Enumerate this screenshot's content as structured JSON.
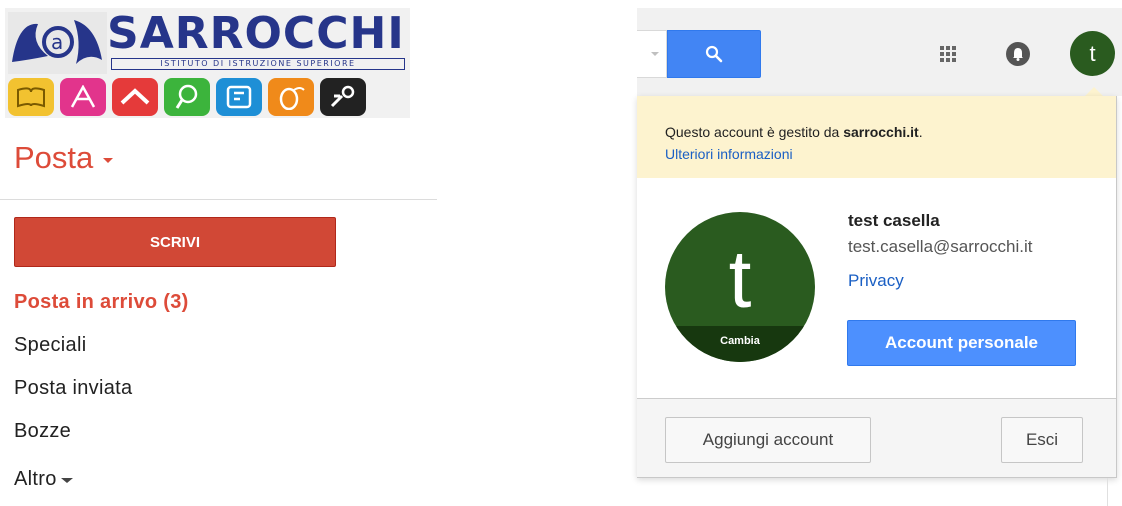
{
  "logo": {
    "name": "SARROCCHI",
    "subtitle": "ISTITUTO DI ISTRUZIONE SUPERIORE",
    "tile_colors": [
      "#f2c230",
      "#e2348c",
      "#e53a3a",
      "#3cb43c",
      "#1e8fd6",
      "#f08a1a",
      "#222222"
    ]
  },
  "sidebar": {
    "title": "Posta",
    "compose_label": "SCRIVI",
    "items": [
      {
        "label": "Posta in arrivo (3)",
        "active": true
      },
      {
        "label": "Speciali"
      },
      {
        "label": "Posta inviata"
      },
      {
        "label": "Bozze"
      },
      {
        "label": "Altro"
      }
    ]
  },
  "header": {
    "avatar_letter": "t",
    "icons": [
      "search-icon",
      "apps-icon",
      "notifications-icon"
    ]
  },
  "account_popup": {
    "notice_text": "Questo account è gestito da",
    "notice_domain": "sarrocchi.it",
    "notice_period": ".",
    "notice_link": "Ulteriori informazioni",
    "avatar_letter": "t",
    "avatar_change_label": "Cambia",
    "user_name": "test casella",
    "user_email": "test.casella@sarrocchi.it",
    "privacy_link": "Privacy",
    "account_button": "Account personale",
    "add_account_button": "Aggiungi account",
    "logout_button": "Esci"
  },
  "colors": {
    "brand_red": "#dd4b39",
    "compose_red": "#d14836",
    "google_blue": "#4285f4",
    "avatar_green": "#2a5b1f",
    "notice_yellow": "#fdf3cf"
  }
}
